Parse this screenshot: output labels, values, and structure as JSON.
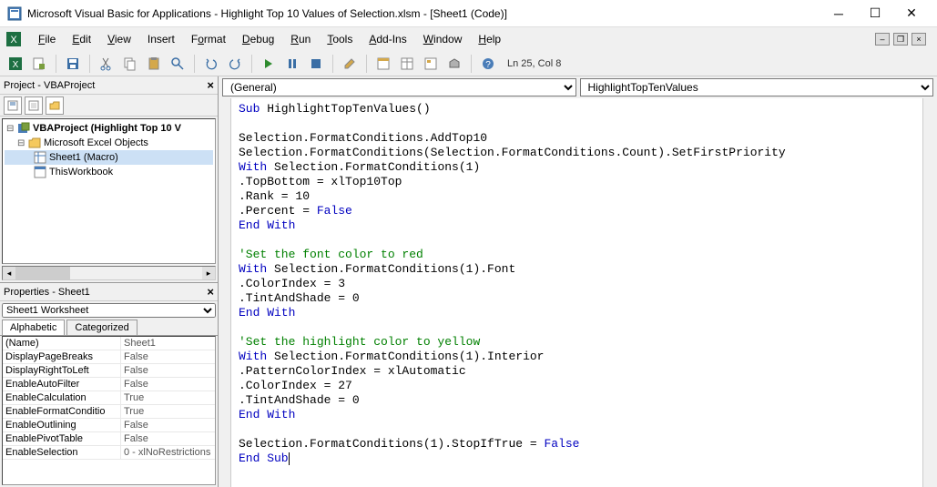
{
  "window": {
    "title": "Microsoft Visual Basic for Applications - Highlight Top 10 Values of Selection.xlsm - [Sheet1 (Code)]"
  },
  "menu": {
    "file": "File",
    "edit": "Edit",
    "view": "View",
    "insert": "Insert",
    "format": "Format",
    "debug": "Debug",
    "run": "Run",
    "tools": "Tools",
    "addins": "Add-Ins",
    "window": "Window",
    "help": "Help"
  },
  "toolbar": {
    "status": "Ln 25, Col 8"
  },
  "project_pane": {
    "title": "Project - VBAProject",
    "root": "VBAProject (Highlight Top 10 V",
    "folder": "Microsoft Excel Objects",
    "sheet1": "Sheet1 (Macro)",
    "wb": "ThisWorkbook"
  },
  "properties_pane": {
    "title": "Properties - Sheet1",
    "object": "Sheet1 Worksheet",
    "tab_alpha": "Alphabetic",
    "tab_cat": "Categorized",
    "rows": [
      {
        "name": "(Name)",
        "value": "Sheet1"
      },
      {
        "name": "DisplayPageBreaks",
        "value": "False"
      },
      {
        "name": "DisplayRightToLeft",
        "value": "False"
      },
      {
        "name": "EnableAutoFilter",
        "value": "False"
      },
      {
        "name": "EnableCalculation",
        "value": "True"
      },
      {
        "name": "EnableFormatConditio",
        "value": "True"
      },
      {
        "name": "EnableOutlining",
        "value": "False"
      },
      {
        "name": "EnablePivotTable",
        "value": "False"
      },
      {
        "name": "EnableSelection",
        "value": "0 - xlNoRestrictions"
      }
    ]
  },
  "code_dropdowns": {
    "general": "(General)",
    "proc": "HighlightTopTenValues"
  },
  "code": {
    "l1a": "Sub",
    "l1b": " HighlightTopTenValues()",
    "l2": "",
    "l3": "Selection.FormatConditions.AddTop10",
    "l4": "Selection.FormatConditions(Selection.FormatConditions.Count).SetFirstPriority",
    "l5a": "With",
    "l5b": " Selection.FormatConditions(1)",
    "l6": ".TopBottom = xlTop10Top",
    "l7": ".Rank = 10",
    "l8a": ".Percent = ",
    "l8b": "False",
    "l9": "End With",
    "l10": "",
    "l11": "'Set the font color to red",
    "l12a": "With",
    "l12b": " Selection.FormatConditions(1).Font",
    "l13": ".ColorIndex = 3",
    "l14": ".TintAndShade = 0",
    "l15": "End With",
    "l16": "",
    "l17": "'Set the highlight color to yellow",
    "l18a": "With",
    "l18b": " Selection.FormatConditions(1).Interior",
    "l19": ".PatternColorIndex = xlAutomatic",
    "l20": ".ColorIndex = 27",
    "l21": ".TintAndShade = 0",
    "l22": "End With",
    "l23": "",
    "l24a": "Selection.FormatConditions(1).StopIfTrue = ",
    "l24b": "False",
    "l25": "End Sub"
  }
}
